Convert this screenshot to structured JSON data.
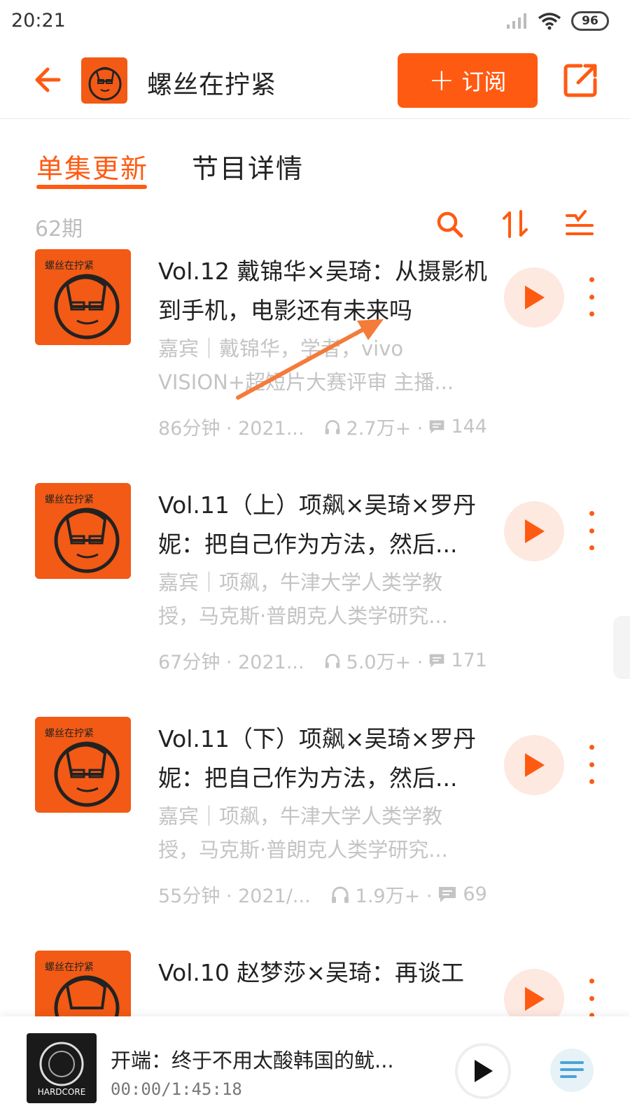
{
  "status_bar": {
    "time": "20:21",
    "battery": "96"
  },
  "header": {
    "title": "螺丝在拧紧",
    "subscribe_label": "订阅",
    "subscribe_plus": "+",
    "cover_text": "螺丝在拧紧"
  },
  "tabs": [
    {
      "label": "单集更新",
      "active": true
    },
    {
      "label": "节目详情",
      "active": false
    }
  ],
  "list": {
    "count": "62期"
  },
  "episodes": [
    {
      "cover_text": "螺丝在拧紧",
      "title": "Vol.12 戴锦华×吴琦：从摄影机到手机，电影还有未来吗",
      "desc": "嘉宾｜戴锦华，学者，vivo VISION+超短片大赛评审 主播...",
      "duration": "86分钟 · 2021...",
      "plays": "2.7万+ ·",
      "comments": "144"
    },
    {
      "cover_text": "螺丝在拧紧",
      "title": "Vol.11（上）项飙×吴琦×罗丹妮：把自己作为方法，然后...",
      "desc": "嘉宾｜项飙，牛津大学人类学教授，马克斯·普朗克人类学研究...",
      "duration": "67分钟 · 2021...",
      "plays": "5.0万+ ·",
      "comments": "171"
    },
    {
      "cover_text": "螺丝在拧紧",
      "title": "Vol.11（下）项飙×吴琦×罗丹妮：把自己作为方法，然后...",
      "desc": "嘉宾｜项飙，牛津大学人类学教授，马克斯·普朗克人类学研究...",
      "duration": "55分钟 · 2021/...",
      "plays": "1.9万+ ·",
      "comments": "69"
    },
    {
      "cover_text": "螺丝在拧紧",
      "title": "Vol.10 赵梦莎×吴琦：再谈工",
      "desc": "",
      "duration": "",
      "plays": "",
      "comments": ""
    }
  ],
  "mini_player": {
    "title": "开端：终于不用太酸韩国的鱿...",
    "time": "00:00/1:45:18",
    "cover_text": "HARDCORE"
  },
  "colors": {
    "accent": "#ff5a12",
    "cover_bg": "#f25a15",
    "muted_text": "#c4c4c4"
  },
  "icons": [
    "back-arrow-icon",
    "share-icon",
    "search-icon",
    "sort-icon",
    "filter-list-icon",
    "play-icon",
    "more-vertical-icon",
    "headphones-icon",
    "comment-icon",
    "playlist-icon"
  ]
}
